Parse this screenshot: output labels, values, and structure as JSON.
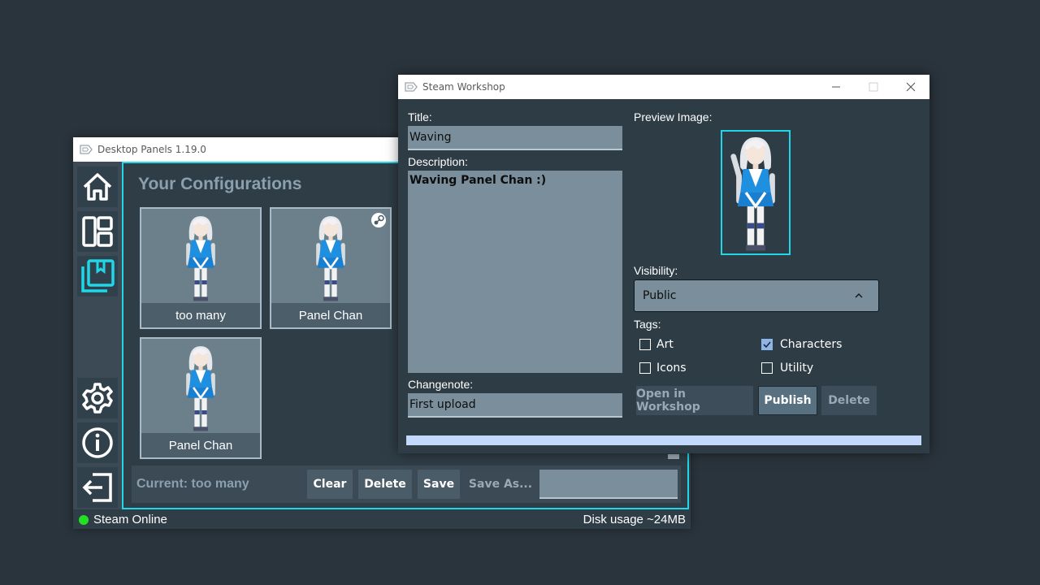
{
  "main_window": {
    "title": "Desktop Panels 1.19.0",
    "sidebar": {
      "items": [
        {
          "name": "home",
          "icon": "home-icon"
        },
        {
          "name": "layout",
          "icon": "layout-icon"
        },
        {
          "name": "configurations",
          "icon": "configurations-icon",
          "active": true
        },
        {
          "name": "settings",
          "icon": "gear-icon"
        },
        {
          "name": "about",
          "icon": "info-icon"
        },
        {
          "name": "exit",
          "icon": "exit-icon"
        }
      ]
    },
    "heading": "Your Configurations",
    "configs": [
      {
        "label": "too many",
        "steam": false
      },
      {
        "label": "Panel Chan",
        "steam": true
      },
      {
        "label": "Panel Chan",
        "steam": false
      }
    ],
    "current_label": "Current: too many",
    "buttons": {
      "clear": "Clear",
      "delete": "Delete",
      "save": "Save",
      "save_as": "Save As..."
    },
    "save_as_value": "",
    "status": {
      "steam": "Steam Online",
      "disk": "Disk usage ~24MB"
    }
  },
  "workshop_window": {
    "title": "Steam Workshop",
    "title_label": "Title:",
    "title_value": "Waving",
    "description_label": "Description:",
    "description_value": "Waving Panel Chan :)",
    "changenote_label": "Changenote:",
    "changenote_value": "First upload",
    "preview_label": "Preview Image:",
    "visibility_label": "Visibility:",
    "visibility_value": "Public",
    "tags_label": "Tags:",
    "tags": [
      {
        "label": "Art",
        "checked": false
      },
      {
        "label": "Characters",
        "checked": true
      },
      {
        "label": "Icons",
        "checked": false
      },
      {
        "label": "Utility",
        "checked": false
      }
    ],
    "buttons": {
      "open": "Open in Workshop",
      "publish": "Publish",
      "delete": "Delete"
    },
    "progress": 1.0
  },
  "colors": {
    "accent": "#1fd7e8",
    "online": "#22e022",
    "progress": "#c2d9fb"
  }
}
